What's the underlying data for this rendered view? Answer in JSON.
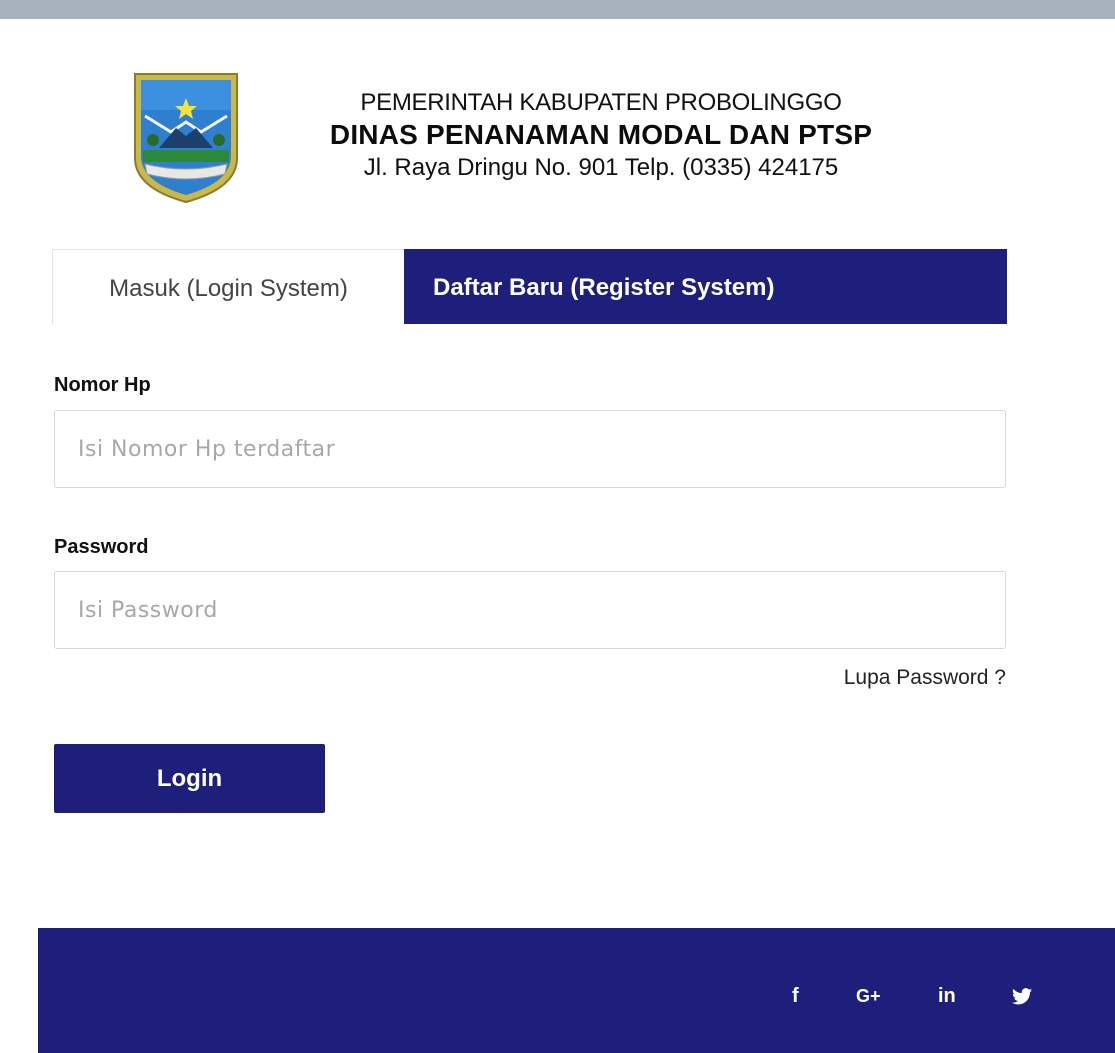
{
  "header": {
    "logo_name": "crest-logo",
    "line1": "PEMERINTAH KABUPATEN PROBOLINGGO",
    "line2": "DINAS PENANAMAN MODAL DAN PTSP",
    "line3": "Jl. Raya Dringu No. 901 Telp. (0335) 424175"
  },
  "tabs": [
    {
      "label": "Masuk (Login System)",
      "active": true
    },
    {
      "label": "Daftar Baru (Register System)",
      "active": false
    }
  ],
  "form": {
    "phone_label": "Nomor Hp",
    "phone_placeholder": "Isi Nomor Hp terdaftar",
    "phone_value": "",
    "password_label": "Password",
    "password_placeholder": "Isi Password",
    "password_value": "",
    "forgot_label": "Lupa Password ?",
    "login_label": "Login"
  },
  "footer": {
    "social": [
      {
        "icon": "facebook-icon",
        "glyph": "f"
      },
      {
        "icon": "google-plus-icon",
        "glyph": "G+"
      },
      {
        "icon": "linkedin-icon",
        "glyph": "in"
      },
      {
        "icon": "twitter-icon",
        "glyph": "twitter-bird"
      }
    ]
  },
  "colors": {
    "primary": "#1e1f7a",
    "top_bar": "#a8b2bd",
    "input_border": "#d8d8d8",
    "placeholder": "#a8a8a8"
  }
}
